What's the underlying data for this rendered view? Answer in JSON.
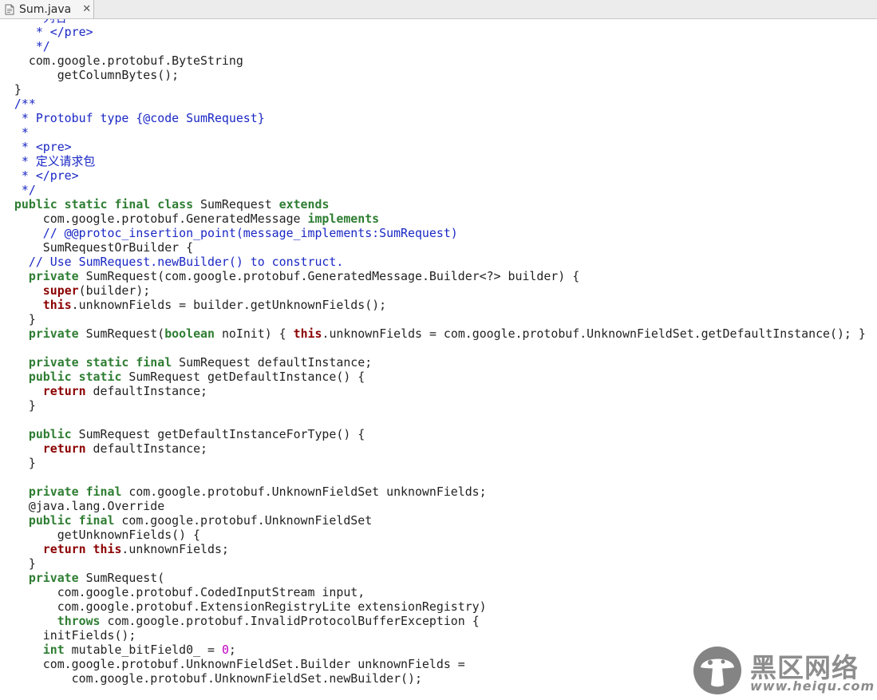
{
  "tab": {
    "filename": "Sum.java",
    "close_glyph": "✕"
  },
  "code_lines": [
    [
      {
        "t": "     *列名",
        "c": "cm"
      }
    ],
    [
      {
        "t": "     * </pre>",
        "c": "cm"
      }
    ],
    [
      {
        "t": "     */",
        "c": "cm"
      }
    ],
    [
      {
        "t": "    com.google.protobuf.ByteString"
      }
    ],
    [
      {
        "t": "        getColumnBytes();"
      }
    ],
    [
      {
        "t": "  }"
      }
    ],
    [
      {
        "t": "  /**",
        "c": "cm"
      }
    ],
    [
      {
        "t": "   * Protobuf type {@code SumRequest}",
        "c": "cm"
      }
    ],
    [
      {
        "t": "   *",
        "c": "cm"
      }
    ],
    [
      {
        "t": "   * <pre>",
        "c": "cm"
      }
    ],
    [
      {
        "t": "   * 定义请求包",
        "c": "cm"
      }
    ],
    [
      {
        "t": "   * </pre>",
        "c": "cm"
      }
    ],
    [
      {
        "t": "   */",
        "c": "cm"
      }
    ],
    [
      {
        "t": "  public static final class",
        "c": "kw"
      },
      {
        "t": " SumRequest "
      },
      {
        "t": "extends",
        "c": "kw"
      }
    ],
    [
      {
        "t": "      com.google.protobuf.GeneratedMessage "
      },
      {
        "t": "implements",
        "c": "kw"
      }
    ],
    [
      {
        "t": "      // @@protoc_insertion_point(message_implements:SumRequest)",
        "c": "cm"
      }
    ],
    [
      {
        "t": "      SumRequestOrBuilder {"
      }
    ],
    [
      {
        "t": "    // Use SumRequest.newBuilder() to construct.",
        "c": "cm"
      }
    ],
    [
      {
        "t": "    private",
        "c": "kw"
      },
      {
        "t": " SumRequest(com.google.protobuf.GeneratedMessage.Builder<?> builder) {"
      }
    ],
    [
      {
        "t": "      "
      },
      {
        "t": "super",
        "c": "kw2"
      },
      {
        "t": "(builder);"
      }
    ],
    [
      {
        "t": "      "
      },
      {
        "t": "this",
        "c": "kw2"
      },
      {
        "t": ".unknownFields = builder.getUnknownFields();"
      }
    ],
    [
      {
        "t": "    }"
      }
    ],
    [
      {
        "t": "    private",
        "c": "kw"
      },
      {
        "t": " SumRequest("
      },
      {
        "t": "boolean",
        "c": "kw"
      },
      {
        "t": " noInit) { "
      },
      {
        "t": "this",
        "c": "kw2"
      },
      {
        "t": ".unknownFields = com.google.protobuf.UnknownFieldSet.getDefaultInstance(); }"
      }
    ],
    [
      {
        "t": ""
      }
    ],
    [
      {
        "t": "    private static final",
        "c": "kw"
      },
      {
        "t": " SumRequest defaultInstance;"
      }
    ],
    [
      {
        "t": "    public static",
        "c": "kw"
      },
      {
        "t": " SumRequest getDefaultInstance() {"
      }
    ],
    [
      {
        "t": "      "
      },
      {
        "t": "return",
        "c": "kw2"
      },
      {
        "t": " defaultInstance;"
      }
    ],
    [
      {
        "t": "    }"
      }
    ],
    [
      {
        "t": ""
      }
    ],
    [
      {
        "t": "    public",
        "c": "kw"
      },
      {
        "t": " SumRequest getDefaultInstanceForType() {"
      }
    ],
    [
      {
        "t": "      "
      },
      {
        "t": "return",
        "c": "kw2"
      },
      {
        "t": " defaultInstance;"
      }
    ],
    [
      {
        "t": "    }"
      }
    ],
    [
      {
        "t": ""
      }
    ],
    [
      {
        "t": "    private final",
        "c": "kw"
      },
      {
        "t": " com.google.protobuf.UnknownFieldSet unknownFields;"
      }
    ],
    [
      {
        "t": "    @java.lang.Override"
      }
    ],
    [
      {
        "t": "    public final",
        "c": "kw"
      },
      {
        "t": " com.google.protobuf.UnknownFieldSet"
      }
    ],
    [
      {
        "t": "        getUnknownFields() {"
      }
    ],
    [
      {
        "t": "      "
      },
      {
        "t": "return this",
        "c": "kw2"
      },
      {
        "t": ".unknownFields;"
      }
    ],
    [
      {
        "t": "    }"
      }
    ],
    [
      {
        "t": "    private",
        "c": "kw"
      },
      {
        "t": " SumRequest("
      }
    ],
    [
      {
        "t": "        com.google.protobuf.CodedInputStream input,"
      }
    ],
    [
      {
        "t": "        com.google.protobuf.ExtensionRegistryLite extensionRegistry)"
      }
    ],
    [
      {
        "t": "        "
      },
      {
        "t": "throws",
        "c": "kw"
      },
      {
        "t": " com.google.protobuf.InvalidProtocolBufferException {"
      }
    ],
    [
      {
        "t": "      initFields();"
      }
    ],
    [
      {
        "t": "      "
      },
      {
        "t": "int",
        "c": "kw"
      },
      {
        "t": " mutable_bitField0_ = "
      },
      {
        "t": "0",
        "c": "num"
      },
      {
        "t": ";"
      }
    ],
    [
      {
        "t": "      com.google.protobuf.UnknownFieldSet.Builder unknownFields ="
      }
    ],
    [
      {
        "t": "          com.google.protobuf.UnknownFieldSet.newBuilder();"
      }
    ]
  ],
  "watermark": {
    "text": "黑区网络",
    "url": "www.heiqu.com"
  }
}
